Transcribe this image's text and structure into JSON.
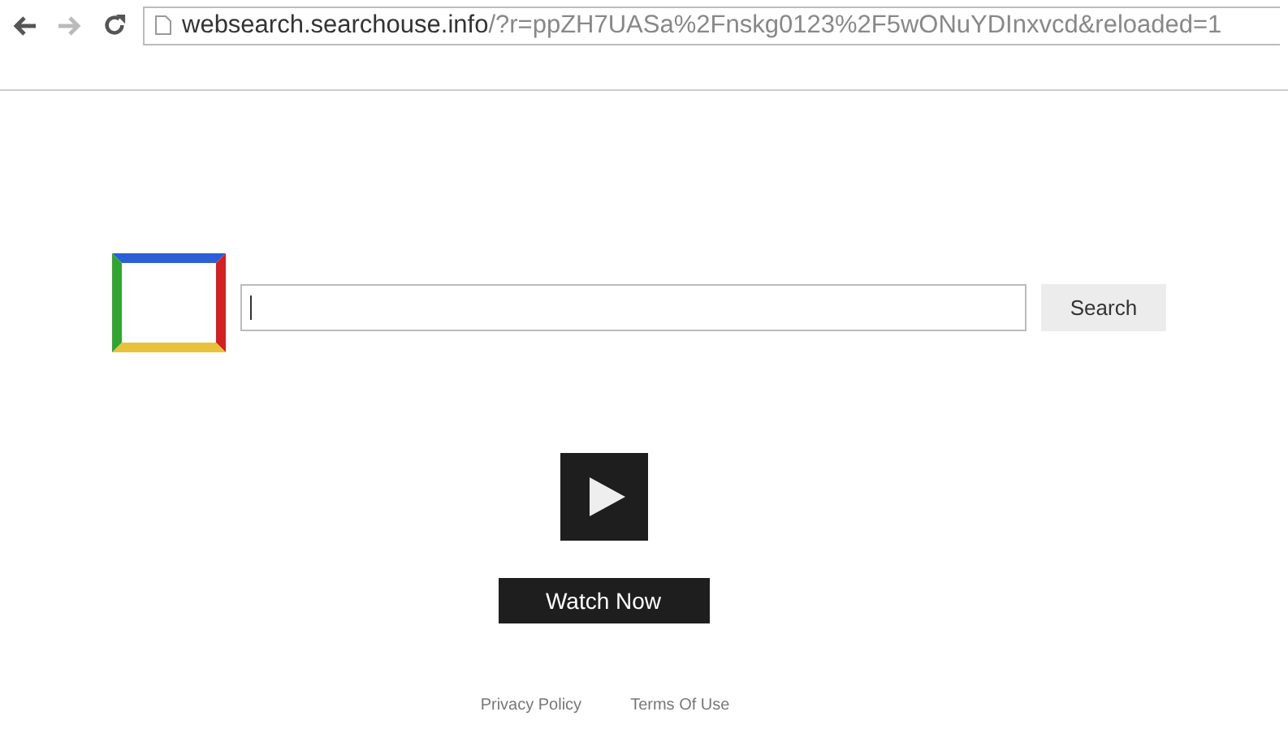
{
  "address_bar": {
    "host": "websearch.searchouse.info",
    "path": "/?r=ppZH7UASa%2Fnskg0123%2F5wONuYDInxvcd&reloaded=1"
  },
  "search": {
    "button": "Search"
  },
  "video": {
    "button": "Watch Now"
  },
  "footer": {
    "links": [
      "Privacy Policy",
      "Terms Of Use"
    ]
  }
}
